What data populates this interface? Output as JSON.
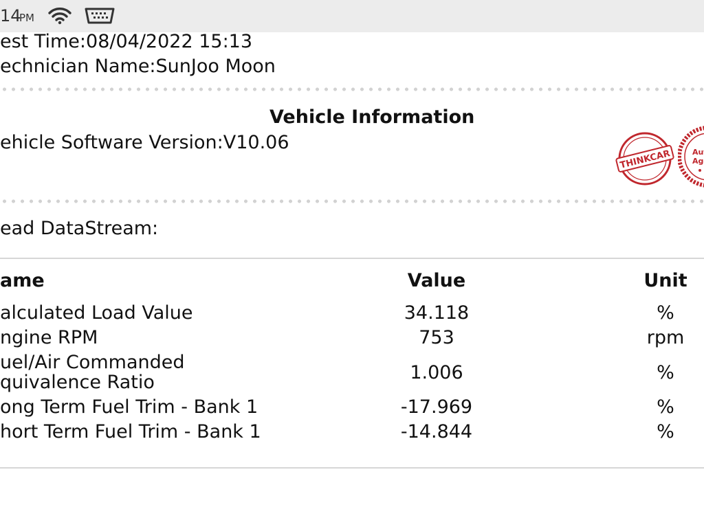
{
  "status_bar": {
    "time": "14",
    "ampm": "PM",
    "icons": [
      "wifi-icon",
      "obd-connector-icon"
    ]
  },
  "report": {
    "test_time": "est Time:08/04/2022 15:13",
    "technician": "echnician Name:SunJoo Moon",
    "vehicle_section_title": "Vehicle Information",
    "software_version": "ehicle Software Version:V10.06",
    "stamps": [
      {
        "text": "THINKCAR",
        "color": "#c0272d"
      },
      {
        "text": "Aut Age",
        "color": "#c0272d"
      }
    ],
    "datastream_label": "ead DataStream:"
  },
  "table": {
    "headers": {
      "name": "ame",
      "value": "Value",
      "unit": "Unit"
    },
    "rows": [
      {
        "name": [
          "alculated Load Value"
        ],
        "value": "34.118",
        "unit": "%"
      },
      {
        "name": [
          "ngine RPM"
        ],
        "value": "753",
        "unit": "rpm"
      },
      {
        "name": [
          "uel/Air Commanded",
          "quivalence Ratio"
        ],
        "value": "1.006",
        "unit": "%"
      },
      {
        "name": [
          "ong Term Fuel Trim - Bank 1"
        ],
        "value": "-17.969",
        "unit": "%"
      },
      {
        "name": [
          "hort Term Fuel Trim - Bank 1"
        ],
        "value": "-14.844",
        "unit": "%"
      }
    ]
  }
}
